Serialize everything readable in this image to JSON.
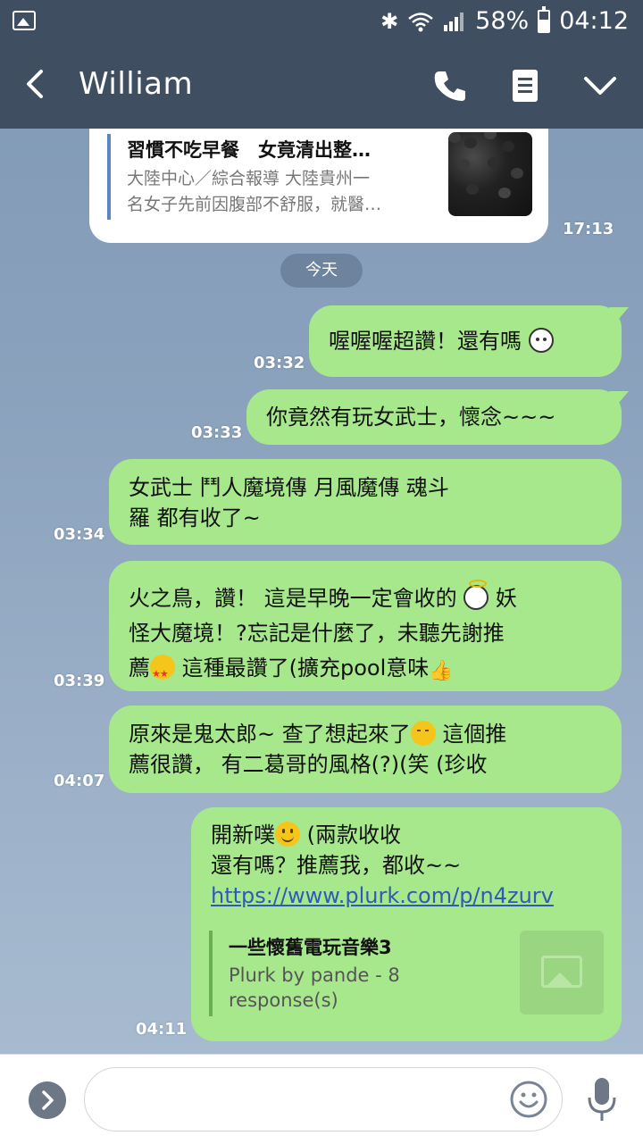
{
  "status_bar": {
    "battery": "58%",
    "time": "04:12",
    "battery_level": 0.58
  },
  "header": {
    "contact_name": "William"
  },
  "link_card": {
    "title": "習慣不吃早餐　女竟清出整…",
    "description_line1": "大陸中心／綜合報導 大陸貴州一",
    "description_line2": "名女子先前因腹部不舒服，就醫…",
    "time": "17:13"
  },
  "date_divider": "今天",
  "messages": [
    {
      "id": "m1",
      "direction": "out",
      "time": "03:32",
      "text": "喔喔喔超讚！還有嗎",
      "emoji": "ghost-face"
    },
    {
      "id": "m2",
      "direction": "out",
      "time": "03:33",
      "text": "你竟然有玩女武士，懷念~~~"
    },
    {
      "id": "m3",
      "direction": "in",
      "time": "03:34",
      "line1": "女武士 鬥人魔境傳 月風魔傳 魂斗",
      "line2": "羅 都有收了~"
    },
    {
      "id": "m4",
      "direction": "in",
      "time": "03:39",
      "line1a": "火之鳥，讚！ 這是早晚一定會收的",
      "line1b": "妖",
      "line2": "怪大魔境！?忘記是什麼了，未聽先謝推",
      "line3a": "薦",
      "line3b": "這種最讚了(擴充pool意味"
    },
    {
      "id": "m5",
      "direction": "in",
      "time": "04:07",
      "line1a": "原來是鬼太郎~ 查了想起來了",
      "line1b": "這個推",
      "line2": "薦很讚， 有二葛哥的風格(?)(笑 (珍收"
    },
    {
      "id": "m6",
      "direction": "in",
      "time": "04:11",
      "line1a": "開新噗",
      "line1b": "(兩款收收",
      "line2": "還有嗎？推薦我，都收~~",
      "link": "https://www.plurk.com/p/n4zurv",
      "preview": {
        "title": "一些懷舊電玩音樂3",
        "desc_line1": "Plurk by pande - 8",
        "desc_line2": "response(s)"
      }
    }
  ],
  "icons": {
    "bluetooth": "bluetooth-icon",
    "wifi": "wifi-icon",
    "signal": "signal-icon",
    "back": "back-arrow-icon",
    "call": "phone-icon",
    "notes": "notes-icon",
    "menu": "chevron-down-icon",
    "expand": "chevron-right-icon",
    "sticker": "smiley-icon",
    "voice": "mic-icon"
  },
  "colors": {
    "header_bg": "#3f4e60",
    "bubble_green": "#a7e88c",
    "link_blue": "#2f5bb7",
    "card_accent": "#5b86c2"
  }
}
